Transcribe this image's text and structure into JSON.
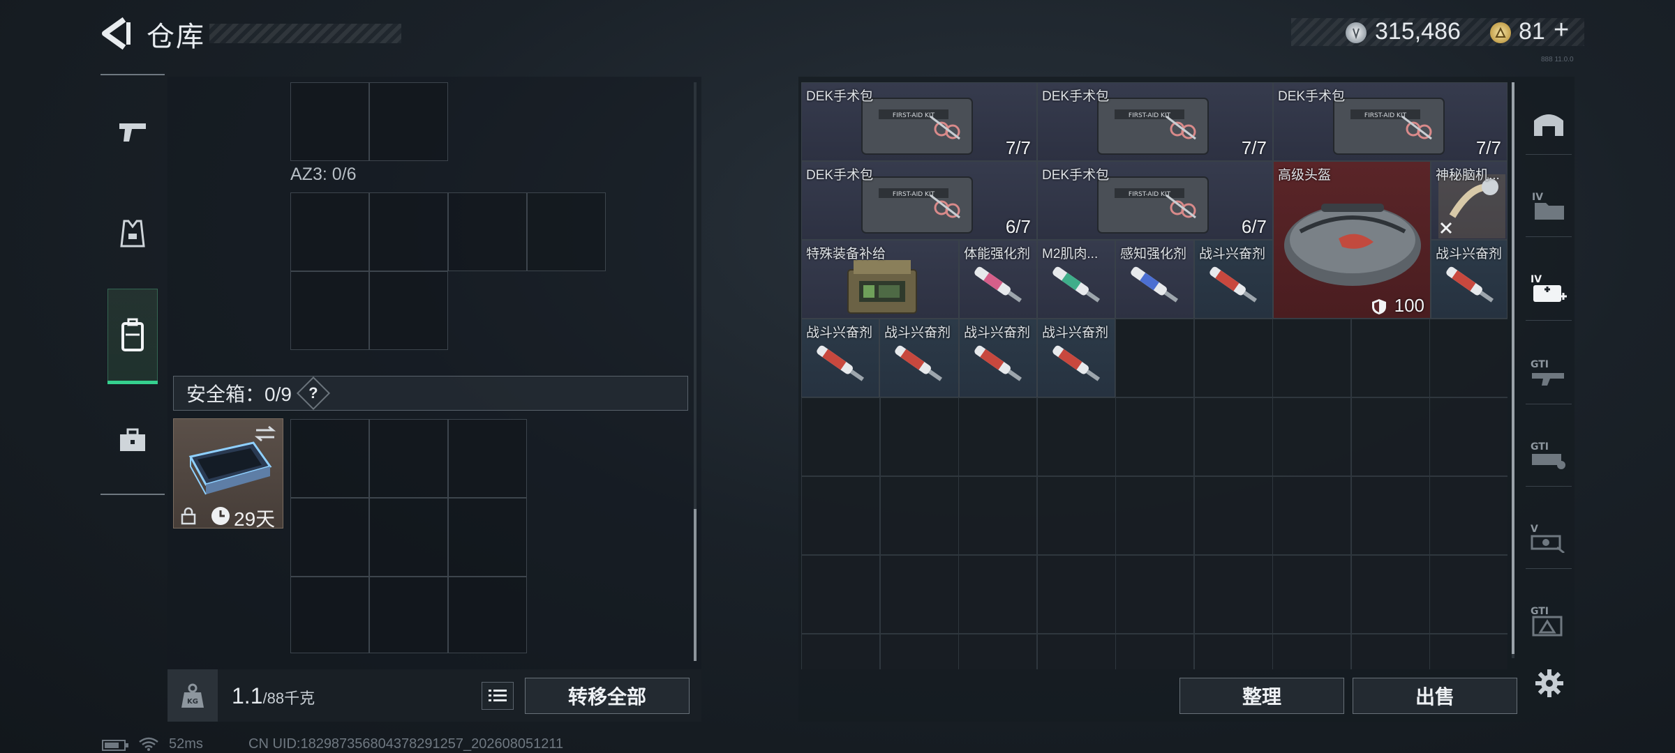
{
  "header": {
    "title": "仓库",
    "currency_silver": "315,486",
    "currency_gold": "81",
    "gold_plus": "+",
    "small_id": "888 11.0.0"
  },
  "left_panel": {
    "az3_label": "AZ3: 0/6",
    "safe_box_label": "安全箱：0/9",
    "help_badge": "?",
    "safe_item_days": "29天",
    "weight_value": "1.1",
    "weight_capacity": "/88千克",
    "transfer_all": "转移全部"
  },
  "inventory": {
    "items": [
      {
        "name": "DEK手术包",
        "count": "7/7"
      },
      {
        "name": "DEK手术包",
        "count": "7/7"
      },
      {
        "name": "DEK手术包",
        "count": "7/7"
      },
      {
        "name": "DEK手术包",
        "count": "6/7"
      },
      {
        "name": "DEK手术包",
        "count": "6/7"
      },
      {
        "name": "高级头盔",
        "count": "100"
      },
      {
        "name": "神秘脑机..."
      },
      {
        "name": "特殊装备补给"
      },
      {
        "name": "体能强化剂"
      },
      {
        "name": "M2肌肉..."
      },
      {
        "name": "感知强化剂"
      },
      {
        "name": "战斗兴奋剂"
      },
      {
        "name": "战斗兴奋剂"
      },
      {
        "name": "战斗兴奋剂"
      },
      {
        "name": "战斗兴奋剂"
      },
      {
        "name": "战斗兴奋剂"
      },
      {
        "name": "战斗兴奋剂"
      }
    ],
    "sort_label": "整理",
    "sell_label": "出售"
  },
  "right_rail": [
    "GTI",
    "GTI",
    "V",
    "GTI"
  ],
  "status_bar": {
    "ping": "52ms",
    "uid": "CN UID:182987356804378291257_202608051211"
  },
  "colors": {
    "accent_green": "#35d08e",
    "rarity_red": "#5a2528",
    "rarity_purple": "#363b4d",
    "rarity_blue": "#2c3a48"
  }
}
